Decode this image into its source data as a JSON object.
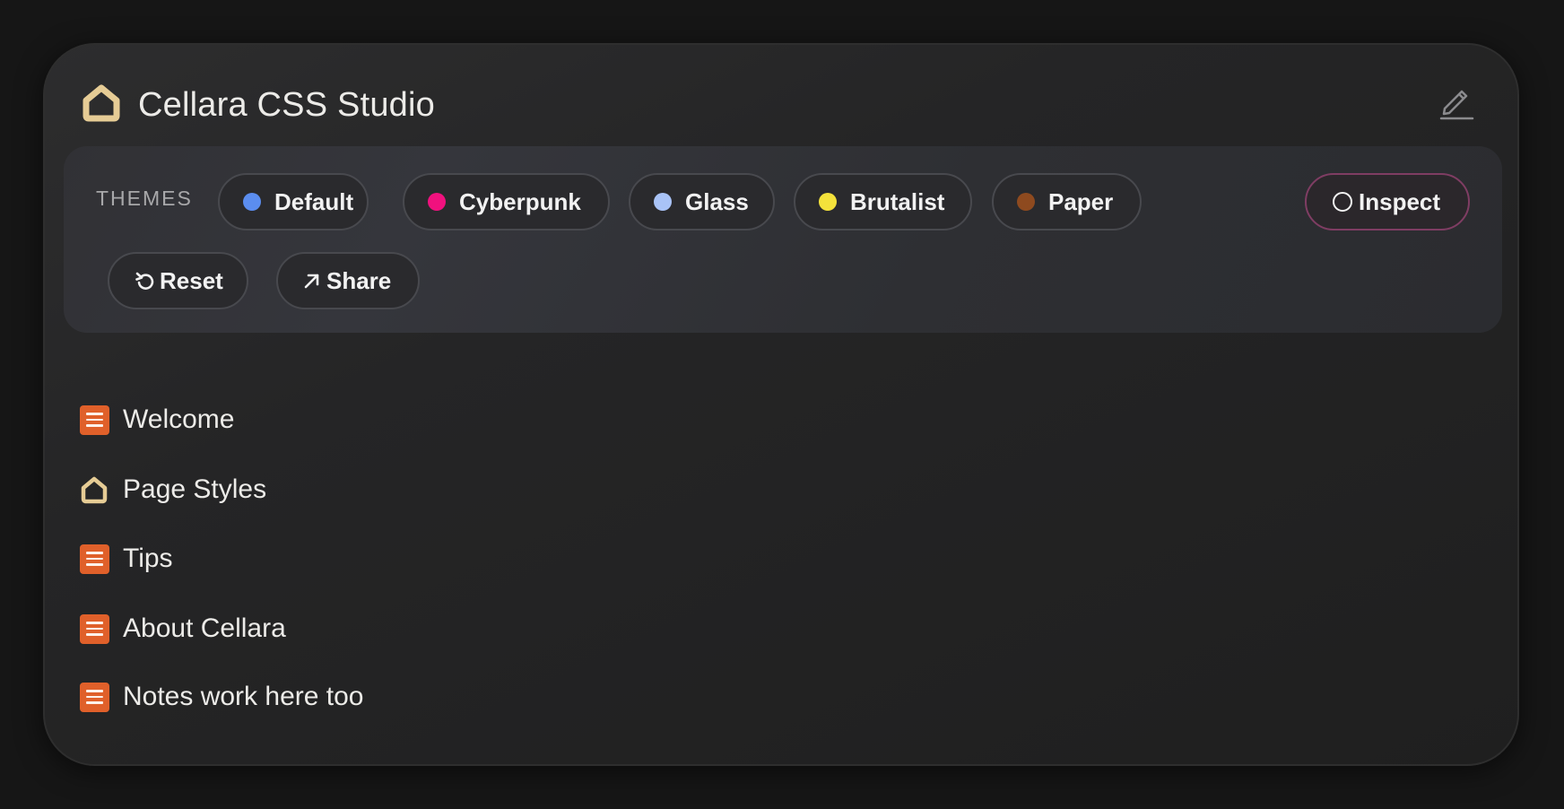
{
  "app": {
    "title": "Cellara CSS Studio"
  },
  "themes": {
    "label": "THEMES",
    "items": [
      {
        "label": "Default",
        "color": "#5b8def"
      },
      {
        "label": "Cyberpunk",
        "color": "#f0117e"
      },
      {
        "label": "Glass",
        "color": "#a9c3f7"
      },
      {
        "label": "Brutalist",
        "color": "#f4e23b"
      },
      {
        "label": "Paper",
        "color": "#8e4a1f"
      }
    ],
    "inspect_label": "Inspect",
    "reset_label": "Reset",
    "share_label": "Share"
  },
  "pages": [
    {
      "label": "Welcome",
      "icon": "document-icon"
    },
    {
      "label": "Page Styles",
      "icon": "home-icon"
    },
    {
      "label": "Tips",
      "icon": "document-icon"
    },
    {
      "label": "About Cellara",
      "icon": "document-icon"
    },
    {
      "label": "Notes work here too",
      "icon": "document-icon"
    }
  ],
  "colors": {
    "background": "#161616",
    "home_icon": "#e6cc95",
    "document_icon": "#e0602a",
    "inspect_border": "#7f3d63"
  }
}
